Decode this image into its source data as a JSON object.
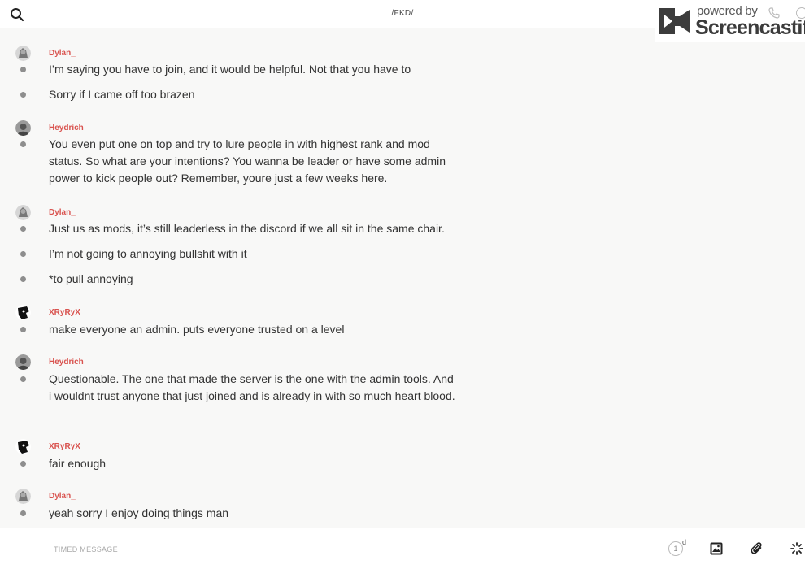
{
  "header": {
    "channel_title": "/FKD/",
    "watermark": {
      "powered": "powered by",
      "brand": "Screencastify"
    }
  },
  "messages": [
    {
      "author": "Dylan_",
      "avatar": "avatar-dylan",
      "lines": [
        "I’m saying you have to join, and it would be helpful. Not that you have to",
        "Sorry if I came off too brazen"
      ]
    },
    {
      "author": "Heydrich",
      "avatar": "avatar-heydrich",
      "lines": [
        "You even put one on top and try to lure people in with highest rank and mod status. So what are your intentions? You wanna be leader or have some admin power to kick people out? Remember, youre just a few weeks here."
      ]
    },
    {
      "author": "Dylan_",
      "avatar": "avatar-dylan",
      "lines": [
        "Just us as mods, it’s still leaderless in the discord if we all sit in the same chair.",
        "I’m not going to annoying bullshit with it",
        "*to pull annoying"
      ]
    },
    {
      "author": "XRyRyX",
      "avatar": "avatar-xryryx",
      "lines": [
        "make everyone an admin. puts everyone trusted on a level"
      ]
    },
    {
      "author": "Heydrich",
      "avatar": "avatar-heydrich",
      "lines": [
        "Questionable. The one that made the server is the one with the admin tools. And i wouldnt trust anyone that just joined and is already in with so much heart blood."
      ]
    },
    {
      "author": "XRyRyX",
      "avatar": "avatar-xryryx",
      "lines": [
        "fair enough"
      ]
    },
    {
      "author": "Dylan_",
      "avatar": "avatar-dylan",
      "lines": [
        "yeah sorry I enjoy doing things man"
      ]
    }
  ],
  "composer": {
    "placeholder": "TIMED MESSAGE",
    "timer_value": "1",
    "timer_unit": "d"
  },
  "colors": {
    "author": "#d9534f",
    "background": "#f8f8f7"
  }
}
